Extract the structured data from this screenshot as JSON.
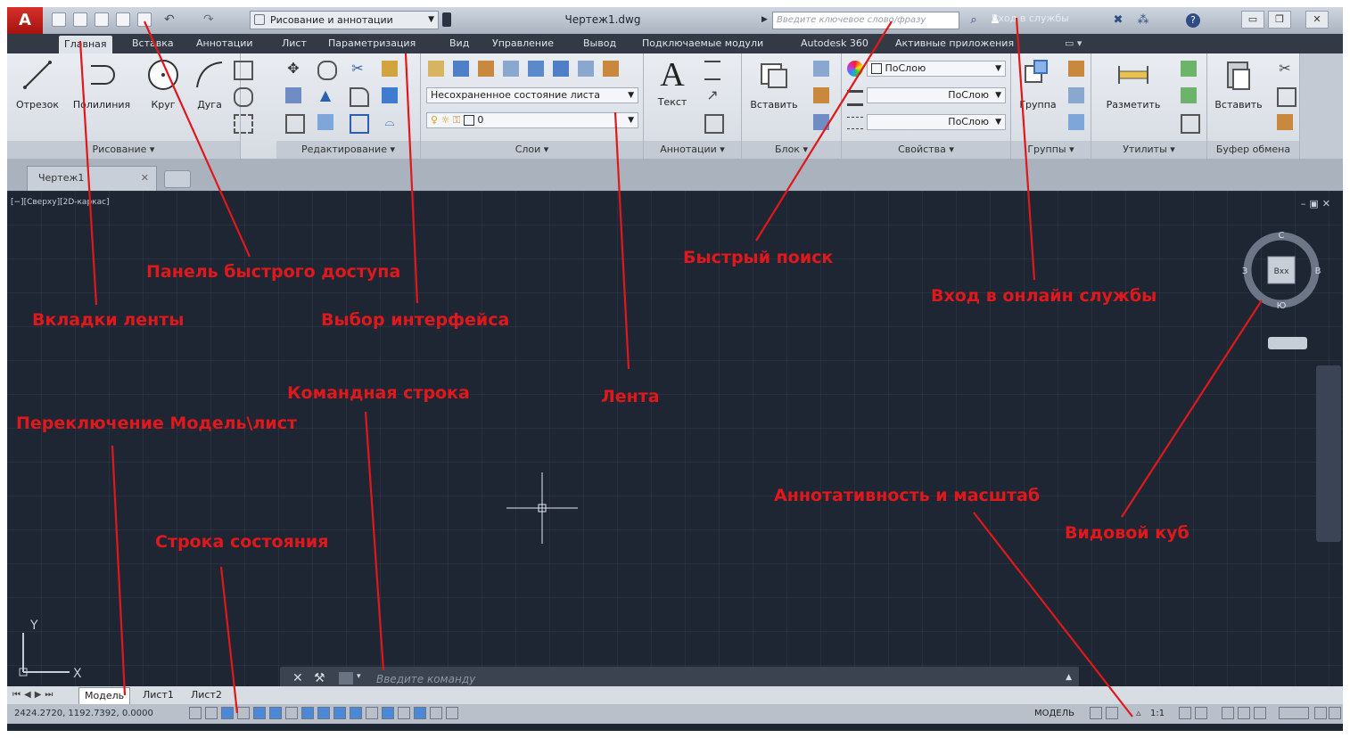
{
  "title_bar": {
    "logo": "A",
    "workspace": "Рисование и аннотации",
    "document": "Чертеж1.dwg",
    "search_placeholder": "Введите ключевое слово/фразу",
    "signin": "Вход в службы"
  },
  "ribbon_tabs": [
    "Главная",
    "Вставка",
    "Аннотации",
    "Лист",
    "Параметризация",
    "Вид",
    "Управление",
    "Вывод",
    "Подключаемые модули",
    "Autodesk 360",
    "Активные приложения"
  ],
  "ribbon": {
    "draw": {
      "title": "Рисование ▾",
      "line": "Отрезок",
      "polyline": "Полилиния",
      "circle": "Круг",
      "arc": "Дуга"
    },
    "modify": {
      "title": "Редактирование ▾"
    },
    "layers": {
      "title": "Слои ▾",
      "layer_state": "Несохраненное состояние листа",
      "layer_current": "0"
    },
    "annotation": {
      "title": "Аннотации ▾",
      "text": "Текст"
    },
    "block": {
      "title": "Блок ▾",
      "insert": "Вставить"
    },
    "properties": {
      "title": "Свойства ▾",
      "bylayer1": "ПоСлою",
      "bylayer2": "ПоСлою",
      "bylayer3": "ПоСлою"
    },
    "groups": {
      "title": "Группы ▾",
      "group": "Группа"
    },
    "utilities": {
      "title": "Утилиты ▾",
      "measure": "Разметить"
    },
    "clipboard": {
      "title": "Буфер обмена",
      "paste": "Вставить"
    }
  },
  "file_tab": "Чертеж1",
  "canvas": {
    "viewport_label": "[−][Сверху][2D-каркас]",
    "viewcube": {
      "top": "Вхх",
      "north": "С",
      "south": "Ю",
      "west": "З",
      "east": "В"
    },
    "ucs_x": "X",
    "ucs_y": "Y",
    "command_prompt": "Введите команду"
  },
  "layout_tabs": [
    "Модель",
    "Лист1",
    "Лист2"
  ],
  "status_bar": {
    "coords": "2424.2720, 1192.7392, 0.0000",
    "model": "МОДЕЛЬ",
    "scale": "1:1"
  },
  "callouts": {
    "ribbon_tabs": "Вкладки ленты",
    "quick_access": "Панель быстрого доступа",
    "interface_choice": "Выбор интерфейса",
    "quick_search": "Быстрый поиск",
    "online_services": "Вход в онлайн службы",
    "ribbon": "Лента",
    "command_line": "Командная строка",
    "model_switch": "Переключение Модель\\лист",
    "status_bar": "Строка состояния",
    "annotation_scale": "Аннотативность и масштаб",
    "viewcube": "Видовой куб"
  },
  "colors": {
    "accent": "#e0181b",
    "canvas": "#1e2634",
    "ribbon": "#dfe4ea"
  }
}
